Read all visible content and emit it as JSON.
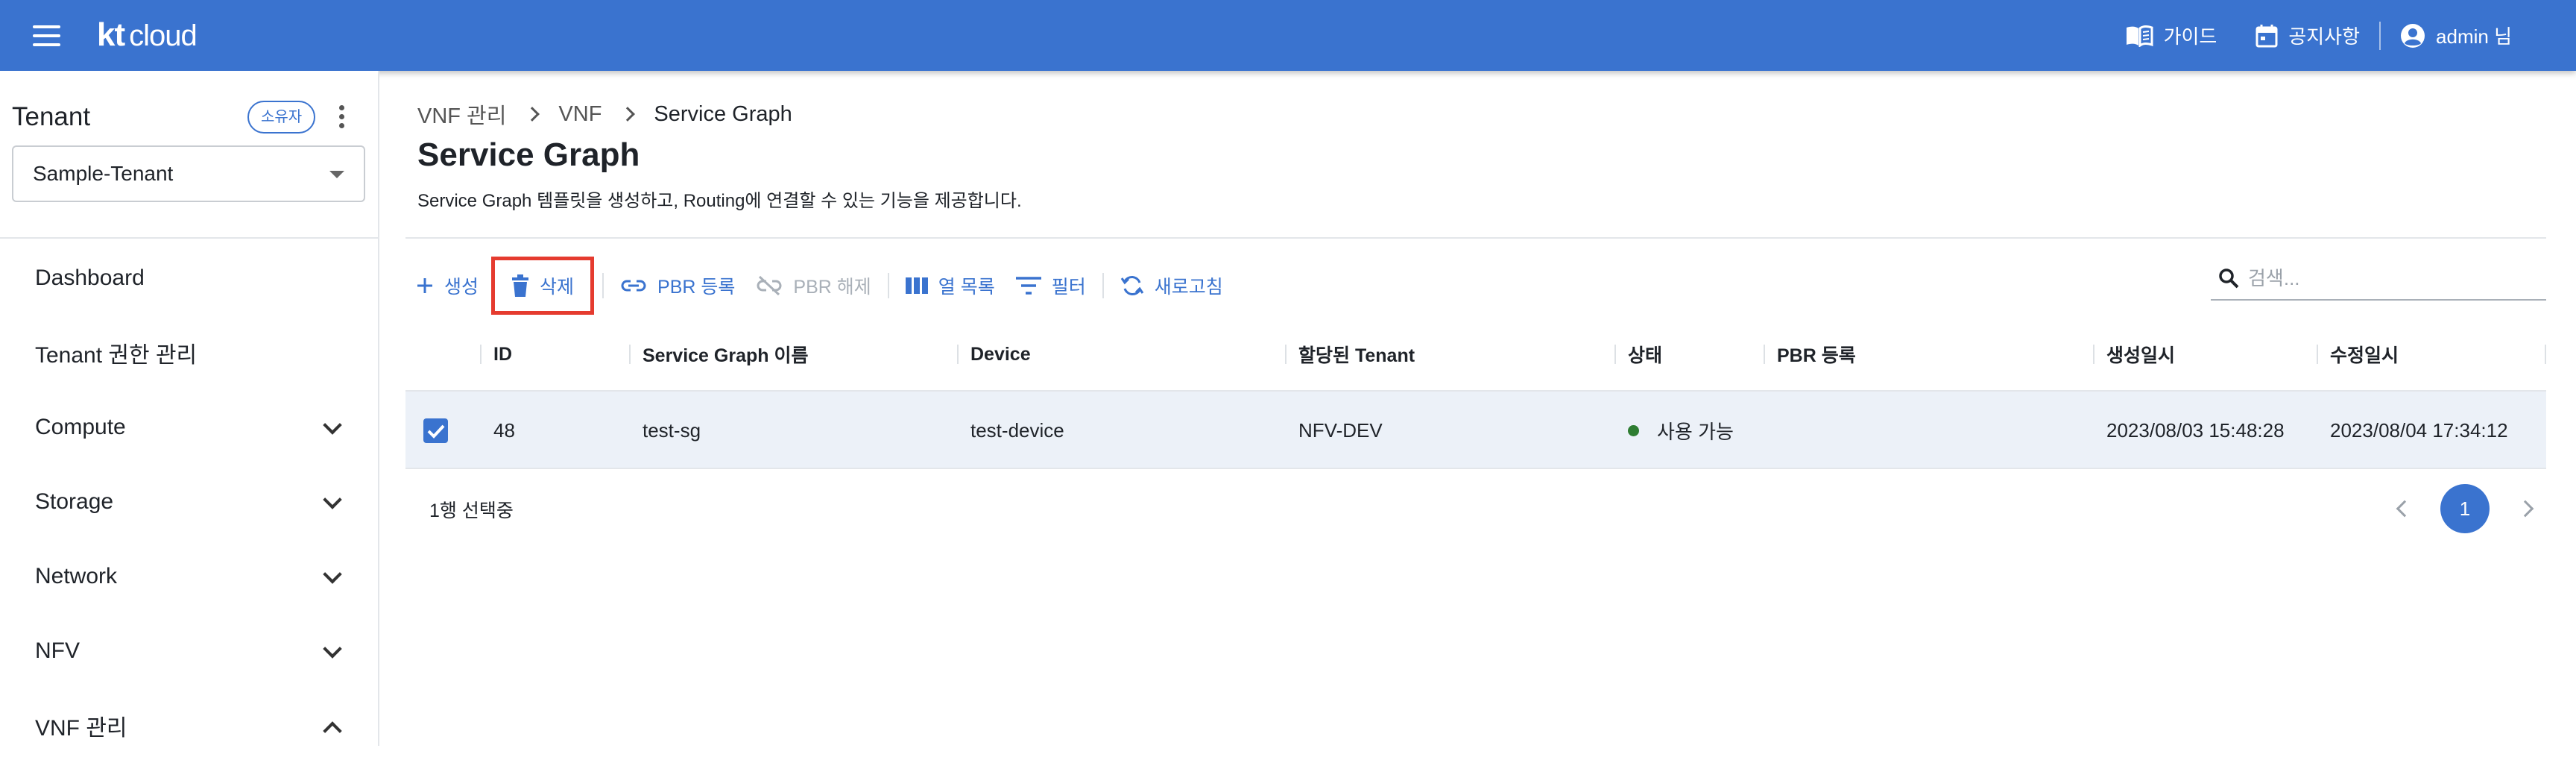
{
  "header": {
    "logo_kt": "kt",
    "logo_cloud": "cloud",
    "guide_label": "가이드",
    "notice_label": "공지사항",
    "user_label": "admin 님"
  },
  "sidebar": {
    "tenant_title": "Tenant",
    "owner_badge": "소유자",
    "tenant_value": "Sample-Tenant",
    "items": [
      {
        "label": "Dashboard",
        "expandable": false
      },
      {
        "label": "Tenant 권한 관리",
        "expandable": false
      },
      {
        "label": "Compute",
        "expandable": true,
        "expanded": false
      },
      {
        "label": "Storage",
        "expandable": true,
        "expanded": false
      },
      {
        "label": "Network",
        "expandable": true,
        "expanded": false
      },
      {
        "label": "NFV",
        "expandable": true,
        "expanded": false
      },
      {
        "label": "VNF 관리",
        "expandable": true,
        "expanded": true
      }
    ]
  },
  "breadcrumb": [
    "VNF 관리",
    "VNF",
    "Service Graph"
  ],
  "page": {
    "title": "Service Graph",
    "description": "Service Graph 템플릿을 생성하고, Routing에 연결할 수 있는 기능을 제공합니다."
  },
  "toolbar": {
    "create": "생성",
    "delete": "삭제",
    "pbr_register": "PBR 등록",
    "pbr_release": "PBR 해제",
    "columns": "열 목록",
    "filter": "필터",
    "refresh": "새로고침"
  },
  "search": {
    "placeholder": "검색..."
  },
  "table": {
    "headers": [
      "ID",
      "Service Graph 이름",
      "Device",
      "할당된 Tenant",
      "상태",
      "PBR 등록",
      "생성일시",
      "수정일시"
    ],
    "rows": [
      {
        "checked": true,
        "id": "48",
        "name": "test-sg",
        "device": "test-device",
        "tenant": "NFV-DEV",
        "status": "사용 가능",
        "pbr": "",
        "created": "2023/08/03 15:48:28",
        "modified": "2023/08/04 17:34:12"
      }
    ],
    "selection_text": "1행 선택중"
  },
  "pagination": {
    "current": "1"
  },
  "colors": {
    "primary": "#3a73cf",
    "highlight": "#e53b2f",
    "status_ok": "#2e7d32",
    "selected_row": "#ecf1f8"
  }
}
